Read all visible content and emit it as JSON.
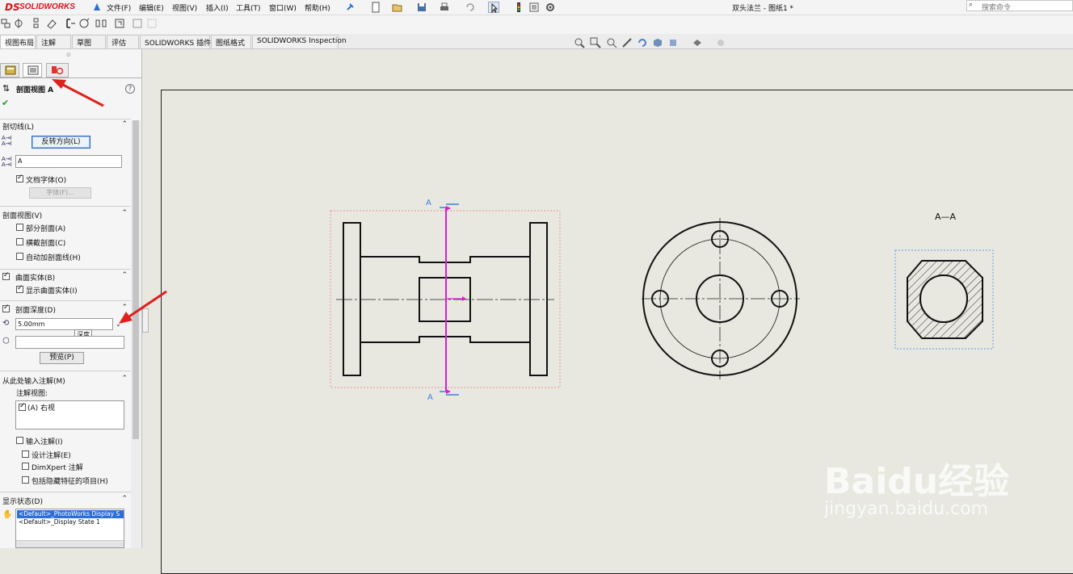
{
  "app": {
    "logo_ds": "DS",
    "logo_name": "SOLIDWORKS",
    "document_title": "双头法兰 - 图纸1 *",
    "search_placeholder": "搜索命令"
  },
  "menu": [
    "文件(F)",
    "编辑(E)",
    "视图(V)",
    "插入(I)",
    "工具(T)",
    "窗口(W)",
    "帮助(H)"
  ],
  "tabs": [
    "视图布局",
    "注解",
    "草图",
    "评估",
    "SOLIDWORKS 插件",
    "图纸格式",
    "SOLIDWORKS Inspection"
  ],
  "panel": {
    "title": "剖面视图 A",
    "help": "?",
    "cutting_line": {
      "header": "剖切线(L)",
      "flip_button": "反转方向(L)",
      "label_value": "A",
      "doc_font": "文档字体(O)",
      "font_button": "字体(F)..."
    },
    "section_view": {
      "header": "剖面视图(V)",
      "partial": "部分剖面(A)",
      "slice": "横截剖面(C)",
      "auto_hatch": "自动加剖面线(H)"
    },
    "surface_bodies": {
      "header": "曲面实体(B)",
      "show": "显示曲面实体(I)"
    },
    "section_depth": {
      "header": "剖面深度(D)",
      "value": "5.00mm",
      "tooltip": "深度",
      "preview_button": "预览(P)"
    },
    "import_annotations": {
      "header": "从此处输入注解(M)",
      "views_label": "注解视图:",
      "view_item": "(A) 右视",
      "import": "输入注解(I)",
      "design": "设计注解(E)",
      "dimxpert": "DimXpert 注解",
      "hidden": "包括隐藏特征的项目(H)"
    },
    "display_state": {
      "header": "显示状态(D)",
      "items": [
        "<Default>_PhotoWorks Display S",
        "<Default>_Display State 1"
      ]
    }
  },
  "drawing": {
    "section_label": "A—A",
    "cut_label_top": "A",
    "cut_label_bottom": "A"
  },
  "colors": {
    "accent_red": "#e0201c",
    "cut_line": "#d81fd0",
    "selection_blue": "#3a7fe0"
  },
  "watermark": {
    "brand": "Baidu经验",
    "url": "jingyan.baidu.com"
  }
}
